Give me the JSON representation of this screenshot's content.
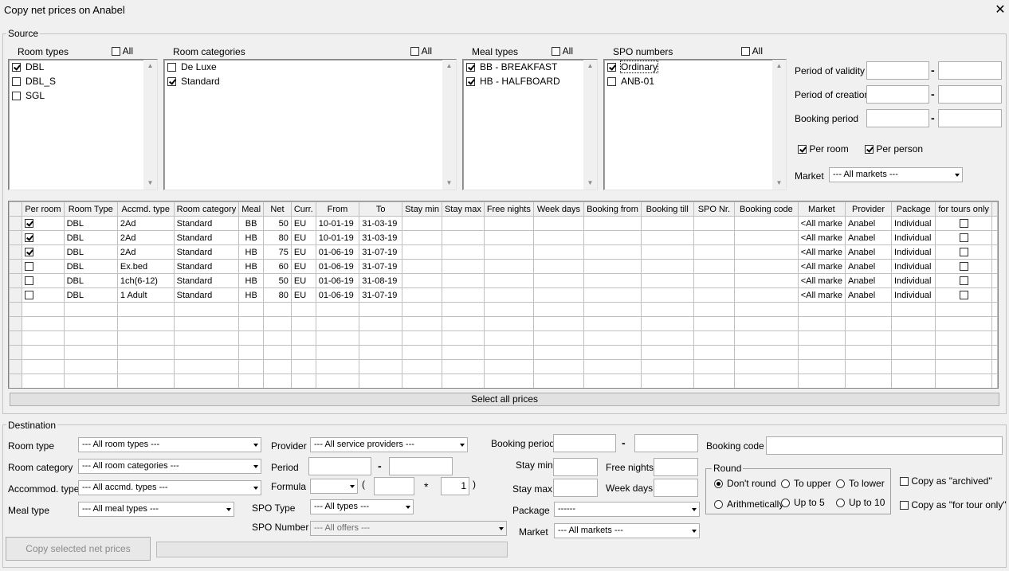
{
  "window": {
    "title": "Copy net prices on Anabel",
    "close": "✕"
  },
  "source": {
    "legend": "Source",
    "all_label": "All",
    "room_types": {
      "label": "Room types",
      "all": false,
      "items": [
        {
          "label": "DBL",
          "checked": true
        },
        {
          "label": "DBL_S",
          "checked": false
        },
        {
          "label": "SGL",
          "checked": false
        }
      ]
    },
    "room_categories": {
      "label": "Room categories",
      "all": false,
      "items": [
        {
          "label": "De Luxe",
          "checked": false
        },
        {
          "label": "Standard",
          "checked": true
        }
      ]
    },
    "meal_types": {
      "label": "Meal types",
      "all": false,
      "items": [
        {
          "label": "BB - BREAKFAST",
          "checked": true
        },
        {
          "label": "HB - HALFBOARD",
          "checked": true
        }
      ]
    },
    "spo_numbers": {
      "label": "SPO numbers",
      "all": false,
      "items": [
        {
          "label": "Ordinary",
          "checked": true
        },
        {
          "label": "ANB-01",
          "checked": false
        }
      ]
    },
    "period_of_validity": "Period of validity",
    "period_of_creation": "Period of creation",
    "booking_period": "Booking period",
    "dash": "-",
    "per_room": {
      "label": "Per room",
      "checked": true
    },
    "per_person": {
      "label": "Per person",
      "checked": true
    },
    "market_label": "Market",
    "market_value": "--- All markets ---"
  },
  "grid": {
    "columns": [
      "Per room",
      "Room Type",
      "Accmd. type",
      "Room category",
      "Meal",
      "Net",
      "Curr.",
      "From",
      "To",
      "Stay min",
      "Stay max",
      "Free nights",
      "Week days",
      "Booking from",
      "Booking till",
      "SPO Nr.",
      "Booking code",
      "Market",
      "Provider",
      "Package",
      "for tours only"
    ],
    "rows": [
      {
        "per_room": true,
        "room_type": "DBL",
        "accmd": "2Ad",
        "category": "Standard",
        "meal": "BB",
        "net": "50",
        "curr": "EU",
        "from": "10-01-19",
        "to": "31-03-19",
        "market": "<All marke",
        "provider": "Anabel",
        "package": "Individual",
        "tours_only": false
      },
      {
        "per_room": true,
        "room_type": "DBL",
        "accmd": "2Ad",
        "category": "Standard",
        "meal": "HB",
        "net": "80",
        "curr": "EU",
        "from": "10-01-19",
        "to": "31-03-19",
        "market": "<All marke",
        "provider": "Anabel",
        "package": "Individual",
        "tours_only": false
      },
      {
        "per_room": true,
        "room_type": "DBL",
        "accmd": "2Ad",
        "category": "Standard",
        "meal": "HB",
        "net": "75",
        "curr": "EU",
        "from": "01-06-19",
        "to": "31-07-19",
        "market": "<All marke",
        "provider": "Anabel",
        "package": "Individual",
        "tours_only": false
      },
      {
        "per_room": false,
        "room_type": "DBL",
        "accmd": "Ex.bed",
        "category": "Standard",
        "meal": "HB",
        "net": "60",
        "curr": "EU",
        "from": "01-06-19",
        "to": "31-07-19",
        "market": "<All marke",
        "provider": "Anabel",
        "package": "Individual",
        "tours_only": false
      },
      {
        "per_room": false,
        "room_type": "DBL",
        "accmd": "1ch(6-12)",
        "category": "Standard",
        "meal": "HB",
        "net": "50",
        "curr": "EU",
        "from": "01-06-19",
        "to": "31-08-19",
        "market": "<All marke",
        "provider": "Anabel",
        "package": "Individual",
        "tours_only": false
      },
      {
        "per_room": false,
        "room_type": "DBL",
        "accmd": "1 Adult",
        "category": "Standard",
        "meal": "HB",
        "net": "80",
        "curr": "EU",
        "from": "01-06-19",
        "to": "31-07-19",
        "market": "<All marke",
        "provider": "Anabel",
        "package": "Individual",
        "tours_only": false
      }
    ],
    "select_all": "Select all prices"
  },
  "destination": {
    "legend": "Destination",
    "room_type": {
      "label": "Room type",
      "value": "--- All room types ---"
    },
    "room_category": {
      "label": "Room category",
      "value": "--- All room categories ---"
    },
    "accommod_type": {
      "label": "Accommod. type",
      "value": "--- All accmd. types ---"
    },
    "meal_type": {
      "label": "Meal type",
      "value": "--- All meal types ---"
    },
    "provider": {
      "label": "Provider",
      "value": "--- All service providers ---"
    },
    "period": {
      "label": "Period"
    },
    "formula": {
      "label": "Formula",
      "open_paren": "(",
      "times": "*",
      "multiplier": "1",
      "close_paren": ")"
    },
    "spo_type": {
      "label": "SPO Type",
      "value": "--- All types ---"
    },
    "spo_number": {
      "label": "SPO Number",
      "value": "--- All offers ---"
    },
    "booking_period": "Booking period",
    "booking_code": "Booking code",
    "stay_min": "Stay min",
    "stay_max": "Stay max",
    "free_nights": "Free nights",
    "week_days": "Week days",
    "package": {
      "label": "Package",
      "value": "------"
    },
    "market": {
      "label": "Market",
      "value": "--- All markets ---"
    },
    "round": {
      "legend": "Round",
      "options": [
        "Don't round",
        "To upper",
        "To lower",
        "Arithmetically",
        "Up to 5",
        "Up to 10"
      ],
      "selected": "Don't round"
    },
    "copy_archived": {
      "label": "Copy as \"archived\"",
      "checked": false
    },
    "copy_tour_only": {
      "label": "Copy as \"for tour only\"",
      "checked": false
    },
    "copy_button": "Copy selected net prices",
    "dash": "-"
  }
}
